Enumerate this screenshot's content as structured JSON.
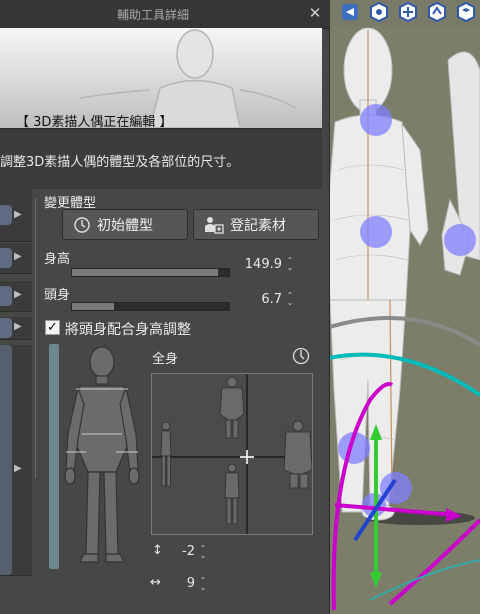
{
  "window": {
    "title": "輔助工具詳細",
    "close_symbol": "✕"
  },
  "preview": {
    "label": "【 3D素描人偶正在編輯 】"
  },
  "description": "調整3D素描人偶的體型及各部位的尺寸。",
  "body_type": {
    "section_label": "變更體型",
    "reset_button": "初始體型",
    "register_button": "登記素材"
  },
  "height": {
    "label": "身高",
    "value": "149.9",
    "fill_fraction": 0.93
  },
  "head": {
    "label": "頭身",
    "value": "6.7",
    "fill_fraction": 0.27
  },
  "link_checkbox": {
    "label": "將頭身配合身高調整",
    "checked": true,
    "check_symbol": "✓"
  },
  "full_body": {
    "label": "全身"
  },
  "offsets": {
    "vertical_symbol": "↕",
    "vertical_value": "-2",
    "horizontal_symbol": "↔",
    "horizontal_value": "9"
  },
  "spin_symbol": "⌃⌄",
  "strip_arrow_symbol": "▶",
  "colors": {
    "panel_bg": "#464646",
    "viewport_bg": "#7c7e6a",
    "joint_marker": "#8080ff",
    "gizmo_green": "#33cc33",
    "gizmo_magenta": "#cc00cc",
    "gizmo_cyan": "#00bbbb"
  },
  "icons": {
    "viewport_tools": [
      "camera-move-icon",
      "rotate-icon",
      "pan-icon",
      "move-icon",
      "layer-icon"
    ]
  }
}
